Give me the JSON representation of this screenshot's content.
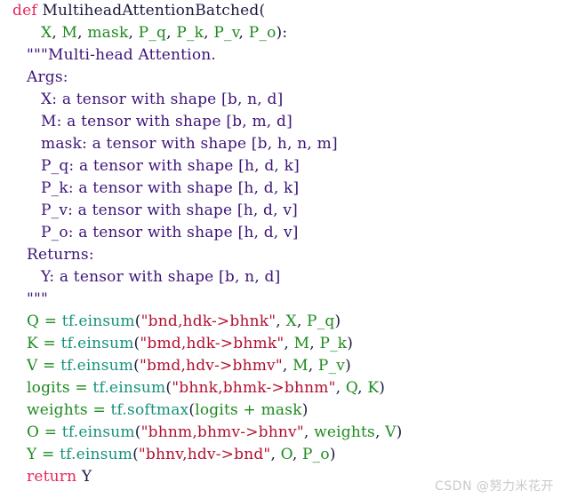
{
  "window": {
    "kind": "code-screenshot",
    "background_color": "#ffffff",
    "language": "python"
  },
  "theme": {
    "keyword_color": "#E8265A",
    "identifier_color": "#1E8A1E",
    "builtin_color": "#169179",
    "string_color": "#B01030",
    "docstring_color": "#3C1478",
    "plain_color": "#1A1A3C",
    "watermark_color": "#c9c9c9"
  },
  "code": {
    "lines": [
      {
        "n": 1,
        "indent": 0,
        "text": "def MultiheadAttentionBatched(",
        "tokens": [
          {
            "t": "def",
            "c": "kw"
          },
          {
            "t": " ",
            "c": "plain"
          },
          {
            "t": "MultiheadAttentionBatched",
            "c": "fname"
          },
          {
            "t": "(",
            "c": "paren"
          }
        ]
      },
      {
        "n": 2,
        "indent": 2,
        "text": "X, M, mask, P_q, P_k, P_v, P_o):",
        "tokens": [
          {
            "t": "X",
            "c": "var"
          },
          {
            "t": ", ",
            "c": "plain"
          },
          {
            "t": "M",
            "c": "var"
          },
          {
            "t": ", ",
            "c": "plain"
          },
          {
            "t": "mask",
            "c": "var"
          },
          {
            "t": ", ",
            "c": "plain"
          },
          {
            "t": "P_q",
            "c": "var"
          },
          {
            "t": ", ",
            "c": "plain"
          },
          {
            "t": "P_k",
            "c": "var"
          },
          {
            "t": ", ",
            "c": "plain"
          },
          {
            "t": "P_v",
            "c": "var"
          },
          {
            "t": ", ",
            "c": "plain"
          },
          {
            "t": "P_o",
            "c": "var"
          },
          {
            "t": "):",
            "c": "paren"
          }
        ]
      },
      {
        "n": 3,
        "indent": 1,
        "text": "\"\"\"Multi-head Attention.",
        "tokens": [
          {
            "t": "\"\"\"Multi-head Attention.",
            "c": "doc"
          }
        ]
      },
      {
        "n": 4,
        "indent": 1,
        "text": "Args:",
        "tokens": [
          {
            "t": "Args:",
            "c": "doc"
          }
        ]
      },
      {
        "n": 5,
        "indent": 2,
        "text": "X: a tensor with shape [b, n, d]",
        "tokens": [
          {
            "t": "X: a tensor with shape [b, n, d]",
            "c": "doc"
          }
        ]
      },
      {
        "n": 6,
        "indent": 2,
        "text": "M: a tensor with shape [b, m, d]",
        "tokens": [
          {
            "t": "M: a tensor with shape [b, m, d]",
            "c": "doc"
          }
        ]
      },
      {
        "n": 7,
        "indent": 2,
        "text": "mask: a tensor with shape [b, h, n, m]",
        "tokens": [
          {
            "t": "mask: a tensor with shape [b, h, n, m]",
            "c": "doc"
          }
        ]
      },
      {
        "n": 8,
        "indent": 2,
        "text": "P_q: a tensor with shape [h, d, k]",
        "tokens": [
          {
            "t": "P_q: a tensor with shape [h, d, k]",
            "c": "doc"
          }
        ]
      },
      {
        "n": 9,
        "indent": 2,
        "text": "P_k: a tensor with shape [h, d, k]",
        "tokens": [
          {
            "t": "P_k: a tensor with shape [h, d, k]",
            "c": "doc"
          }
        ]
      },
      {
        "n": 10,
        "indent": 2,
        "text": "P_v: a tensor with shape [h, d, v]",
        "tokens": [
          {
            "t": "P_v: a tensor with shape [h, d, v]",
            "c": "doc"
          }
        ]
      },
      {
        "n": 11,
        "indent": 2,
        "text": "P_o: a tensor with shape [h, d, v]",
        "tokens": [
          {
            "t": "P_o: a tensor with shape [h, d, v]",
            "c": "doc"
          }
        ]
      },
      {
        "n": 12,
        "indent": 1,
        "text": "Returns:",
        "tokens": [
          {
            "t": "Returns:",
            "c": "doc"
          }
        ]
      },
      {
        "n": 13,
        "indent": 2,
        "text": "Y: a tensor with shape [b, n, d]",
        "tokens": [
          {
            "t": "Y: a tensor with shape [b, n, d]",
            "c": "doc"
          }
        ]
      },
      {
        "n": 14,
        "indent": 1,
        "text": "\"\"\"",
        "tokens": [
          {
            "t": "\"\"\"",
            "c": "doc"
          }
        ]
      },
      {
        "n": 15,
        "indent": 1,
        "text": "Q = tf.einsum(\"bnd,hdk->bhnk\", X, P_q)",
        "tokens": [
          {
            "t": "Q",
            "c": "var"
          },
          {
            "t": " = ",
            "c": "op"
          },
          {
            "t": "tf.einsum",
            "c": "builtin"
          },
          {
            "t": "(",
            "c": "paren"
          },
          {
            "t": "\"bnd,hdk->bhnk\"",
            "c": "str"
          },
          {
            "t": ", ",
            "c": "plain"
          },
          {
            "t": "X",
            "c": "var"
          },
          {
            "t": ", ",
            "c": "plain"
          },
          {
            "t": "P_q",
            "c": "var"
          },
          {
            "t": ")",
            "c": "paren"
          }
        ]
      },
      {
        "n": 16,
        "indent": 1,
        "text": "K = tf.einsum(\"bmd,hdk->bhmk\", M, P_k)",
        "tokens": [
          {
            "t": "K",
            "c": "var"
          },
          {
            "t": " = ",
            "c": "op"
          },
          {
            "t": "tf.einsum",
            "c": "builtin"
          },
          {
            "t": "(",
            "c": "paren"
          },
          {
            "t": "\"bmd,hdk->bhmk\"",
            "c": "str"
          },
          {
            "t": ", ",
            "c": "plain"
          },
          {
            "t": "M",
            "c": "var"
          },
          {
            "t": ", ",
            "c": "plain"
          },
          {
            "t": "P_k",
            "c": "var"
          },
          {
            "t": ")",
            "c": "paren"
          }
        ]
      },
      {
        "n": 17,
        "indent": 1,
        "text": "V = tf.einsum(\"bmd,hdv->bhmv\", M, P_v)",
        "tokens": [
          {
            "t": "V",
            "c": "var"
          },
          {
            "t": " = ",
            "c": "op"
          },
          {
            "t": "tf.einsum",
            "c": "builtin"
          },
          {
            "t": "(",
            "c": "paren"
          },
          {
            "t": "\"bmd,hdv->bhmv\"",
            "c": "str"
          },
          {
            "t": ", ",
            "c": "plain"
          },
          {
            "t": "M",
            "c": "var"
          },
          {
            "t": ", ",
            "c": "plain"
          },
          {
            "t": "P_v",
            "c": "var"
          },
          {
            "t": ")",
            "c": "paren"
          }
        ]
      },
      {
        "n": 18,
        "indent": 1,
        "text": "logits = tf.einsum(\"bhnk,bhmk->bhnm\", Q, K)",
        "tokens": [
          {
            "t": "logits",
            "c": "var"
          },
          {
            "t": " = ",
            "c": "op"
          },
          {
            "t": "tf.einsum",
            "c": "builtin"
          },
          {
            "t": "(",
            "c": "paren"
          },
          {
            "t": "\"bhnk,bhmk->bhnm\"",
            "c": "str"
          },
          {
            "t": ", ",
            "c": "plain"
          },
          {
            "t": "Q",
            "c": "var"
          },
          {
            "t": ", ",
            "c": "plain"
          },
          {
            "t": "K",
            "c": "var"
          },
          {
            "t": ")",
            "c": "paren"
          }
        ]
      },
      {
        "n": 19,
        "indent": 1,
        "text": "weights = tf.softmax(logits + mask)",
        "tokens": [
          {
            "t": "weights",
            "c": "var"
          },
          {
            "t": " = ",
            "c": "op"
          },
          {
            "t": "tf.softmax",
            "c": "builtin"
          },
          {
            "t": "(",
            "c": "paren"
          },
          {
            "t": "logits",
            "c": "var"
          },
          {
            "t": " + ",
            "c": "op"
          },
          {
            "t": "mask",
            "c": "var"
          },
          {
            "t": ")",
            "c": "paren"
          }
        ]
      },
      {
        "n": 20,
        "indent": 1,
        "text": "O = tf.einsum(\"bhnm,bhmv->bhnv\", weights, V)",
        "tokens": [
          {
            "t": "O",
            "c": "var"
          },
          {
            "t": " = ",
            "c": "op"
          },
          {
            "t": "tf.einsum",
            "c": "builtin"
          },
          {
            "t": "(",
            "c": "paren"
          },
          {
            "t": "\"bhnm,bhmv->bhnv\"",
            "c": "str"
          },
          {
            "t": ", ",
            "c": "plain"
          },
          {
            "t": "weights",
            "c": "var"
          },
          {
            "t": ", ",
            "c": "plain"
          },
          {
            "t": "V",
            "c": "var"
          },
          {
            "t": ")",
            "c": "paren"
          }
        ]
      },
      {
        "n": 21,
        "indent": 1,
        "text": "Y = tf.einsum(\"bhnv,hdv->bnd\", O, P_o)",
        "tokens": [
          {
            "t": "Y",
            "c": "var"
          },
          {
            "t": " = ",
            "c": "op"
          },
          {
            "t": "tf.einsum",
            "c": "builtin"
          },
          {
            "t": "(",
            "c": "paren"
          },
          {
            "t": "\"bhnv,hdv->bnd\"",
            "c": "str"
          },
          {
            "t": ", ",
            "c": "plain"
          },
          {
            "t": "O",
            "c": "var"
          },
          {
            "t": ", ",
            "c": "plain"
          },
          {
            "t": "P_o",
            "c": "var"
          },
          {
            "t": ")",
            "c": "paren"
          }
        ]
      },
      {
        "n": 22,
        "indent": 1,
        "text": "return Y",
        "tokens": [
          {
            "t": "return",
            "c": "kw"
          },
          {
            "t": " ",
            "c": "plain"
          },
          {
            "t": "Y",
            "c": "plain"
          }
        ]
      }
    ]
  },
  "watermark": {
    "text": "CSDN @努力米花开"
  }
}
